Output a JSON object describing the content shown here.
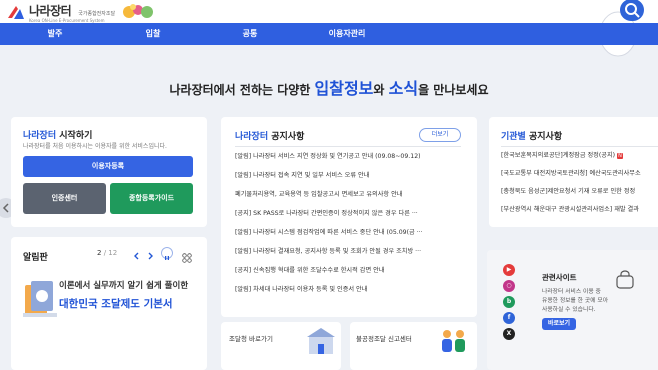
{
  "header": {
    "logo_text": "나라장터",
    "logo_subtitle": "국가종합전자조달",
    "logo_english": "Korea ON-Line E-Procurement System"
  },
  "nav": [
    "발주",
    "입찰",
    "공통",
    "이용자관리"
  ],
  "headline": {
    "prefix": "나라장터에서 전하는 다양한",
    "highlight1": "입찰정보",
    "middle": "와",
    "highlight2": "소식",
    "suffix": "을 만나보세요"
  },
  "start_card": {
    "title_brand": "나라장터",
    "title_rest": " 시작하기",
    "description": "나라장터를 처음 이용하시는 이용자를 위한 서비스입니다.",
    "register_button": "이용자등록",
    "cert_button": "인증센터",
    "guide_button": "종합등록가이드"
  },
  "notice_card": {
    "title_brand": "나라장터",
    "title_rest": " 공지사항",
    "more_label": "더보기",
    "items": [
      "[알림] 나라장터 서비스 지연 정상화 및 연기공고 안내 (09.08~09.12)",
      "[알림] 나라장터 접속 지연 및 일부 서비스 오류 안내",
      "폐기물처리용역, 교육용역 등 입찰공고시 면세보고 유의사항 안내",
      "[공지] SK PASS로 나라장터 간편인증이 정상적이지 않은 경우 다른 ···",
      "[알림] 나라장터 시스템 점검작업에 따른 서비스 중단 안내 (05.09(금 ···",
      "[알림] 나라장터 결재요청, 공지사항 등록 및 조회가 안될 경우 조치방 ···",
      "[공지] 신속집행 혁대를 위한 조달수수료 한시적 감면 안내",
      "[알림] 차세대 나라장터 이용자 등록 및 인증서 안내"
    ]
  },
  "agency_card": {
    "title_brand": "기관별",
    "title_rest": " 공지사항",
    "items": [
      "[한국보훈복지의료공단]계정잠금 정정(공지)",
      "[국도교통부 대전지방국토관리청] 예산국도관리사무소",
      "[충청북도 음성군]제안요청서 기재 오류로 인한 정정",
      "[부산광역시 해운대구 관광시설관리사업소] 재발 결과"
    ],
    "new_badge": "N"
  },
  "alert_card": {
    "title": "알림판",
    "page_current": "2",
    "page_total": "12",
    "banner_line1": "이론에서 실무까지 알기 쉽게 풀이한",
    "banner_line2": "대한민국 조달제도 기본서"
  },
  "bottom_links": {
    "link1": "조달청 바로가기",
    "link2": "불공정조달 신고센터"
  },
  "related_card": {
    "title": "관련사이트",
    "line1": "나라장터 서비스 이용 중",
    "line2": "유용한 정보를 한 곳에 모아",
    "line3": "사용하실 수 있습니다.",
    "button": "바로보기"
  },
  "colors": {
    "primary": "#2f5fe0",
    "accent": "#1f52d6",
    "green": "#1f9a5c",
    "gray_button": "#5b6370"
  }
}
